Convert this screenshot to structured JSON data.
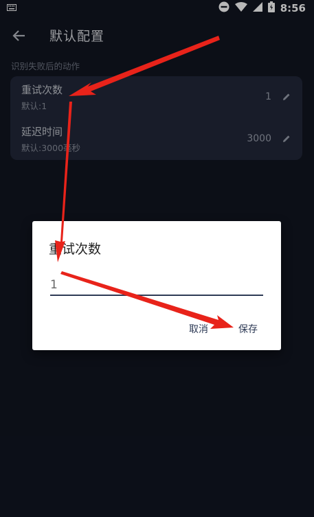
{
  "status_bar": {
    "time": "8:56",
    "icons": [
      "keyboard-icon",
      "do-not-disturb-icon",
      "wifi-icon",
      "signal-icon",
      "battery-icon"
    ]
  },
  "app_bar": {
    "title": "默认配置",
    "back_icon": "arrow-back-icon"
  },
  "section": {
    "title": "识别失败后的动作"
  },
  "settings": [
    {
      "label": "重试次数",
      "sub": "默认:1",
      "value": "1",
      "icon": "edit-pencil-icon"
    },
    {
      "label": "延迟时间",
      "sub": "默认:3000毫秒",
      "value": "3000",
      "icon": "edit-pencil-icon"
    }
  ],
  "dialog": {
    "title": "重试次数",
    "input_value": "1",
    "cancel_label": "取消",
    "save_label": "保存"
  },
  "colors": {
    "background": "#111521",
    "card": "#22283a",
    "dialog_accent": "#2d3a55",
    "annotation_arrow": "#e8231a"
  }
}
